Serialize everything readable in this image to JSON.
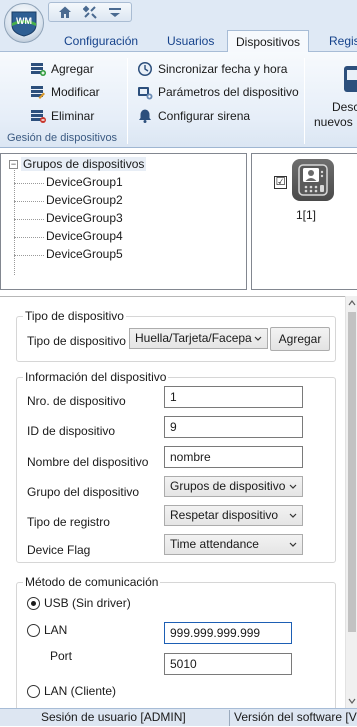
{
  "app": {
    "logo_text": "WM"
  },
  "quick_access": [
    {
      "icon": "home-icon"
    },
    {
      "icon": "tools-icon"
    },
    {
      "icon": "dropdown-menu-icon"
    }
  ],
  "tabs": [
    {
      "label": "Configuración",
      "active": false
    },
    {
      "label": "Usuarios",
      "active": false
    },
    {
      "label": "Dispositivos",
      "active": true
    },
    {
      "label": "Regis",
      "active": false
    }
  ],
  "ribbon": {
    "device_group": {
      "label": "Gesión de dispositivos",
      "buttons": [
        {
          "label": "Agregar",
          "icon": "add-device-icon"
        },
        {
          "label": "Modificar",
          "icon": "edit-device-icon"
        },
        {
          "label": "Eliminar",
          "icon": "delete-device-icon"
        }
      ]
    },
    "device_actions": [
      {
        "label": "Sincronizar fecha y hora",
        "icon": "clock-sync-icon"
      },
      {
        "label": "Parámetros del dispositivo",
        "icon": "device-params-icon"
      },
      {
        "label": "Configurar sirena",
        "icon": "siren-bell-icon"
      }
    ],
    "download": {
      "label_line1": "Desc",
      "label_line2": "nuevos",
      "icon": "download-icon"
    }
  },
  "device_tree": {
    "root": "Grupos de dispositivos",
    "groups": [
      "DeviceGroup1",
      "DeviceGroup2",
      "DeviceGroup3",
      "DeviceGroup4",
      "DeviceGroup5"
    ]
  },
  "device_list": {
    "items": [
      {
        "label": "1[1]",
        "checked": true,
        "check_mark": "☑",
        "icon": "fingerprint-terminal-icon"
      }
    ]
  },
  "form": {
    "device_type_section": {
      "legend": "Tipo de dispositivo",
      "label": "Tipo de dispositivo",
      "value": "Huella/Tarjeta/Facepa",
      "button": "Agregar"
    },
    "device_info_section": {
      "legend": "Información del dispositivo",
      "fields": {
        "device_no": {
          "label": "Nro. de dispositivo",
          "value": "1"
        },
        "device_id": {
          "label": "ID de dispositivo",
          "value": "9"
        },
        "device_name": {
          "label": "Nombre del dispositivo",
          "value": "nombre"
        },
        "device_group": {
          "label": "Grupo del dispositivo",
          "value": "Grupos de dispositivo"
        },
        "register_type": {
          "label": "Tipo de registro",
          "value": "Respetar dispositivo"
        },
        "device_flag": {
          "label": "Device Flag",
          "value": "Time attendance"
        }
      }
    },
    "comm_section": {
      "legend": "Método de comunicación",
      "usb": {
        "label": "USB (Sin driver)",
        "selected": true
      },
      "lan": {
        "label": "LAN",
        "selected": false,
        "ip_value": "999.999.999.999"
      },
      "port": {
        "label": "Port",
        "value": "5010"
      },
      "lan_client": {
        "label": "LAN (Cliente)",
        "selected": false
      }
    }
  },
  "status_bar": {
    "session": "Sesión de usuario  [ADMIN]",
    "version": "Versión del software  [V"
  },
  "colors": {
    "ribbon_text": "#15428b",
    "accent": "#1d5fb4",
    "ribbon_bg": "#e6eef8"
  }
}
